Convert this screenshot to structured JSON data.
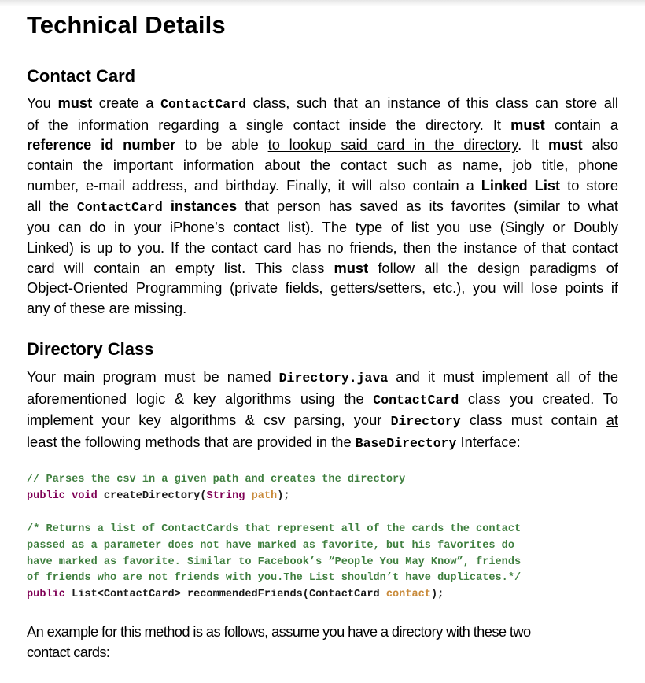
{
  "document": {
    "title": "Technical Details",
    "sections": [
      {
        "heading": "Contact Card",
        "paragraph_lines": [
          [
            "You ",
            {
              "b": "must"
            },
            " create a ",
            {
              "code": "ContactCard"
            },
            " class, such that an instance of this class can store all"
          ],
          [
            "of the information regarding a single contact inside the directory. It ",
            {
              "b": "must"
            },
            " contain a"
          ],
          [
            {
              "b": "reference id number"
            },
            " to be able ",
            {
              "u": "to lookup said card in the directory"
            },
            ". It ",
            {
              "b": "must"
            },
            " also"
          ],
          [
            "contain the important information about the contact such as name, job title, phone"
          ],
          [
            "number, e-mail address, and birthday. Finally, it will also contain a ",
            {
              "b": "Linked List"
            },
            " to store"
          ],
          [
            "all the ",
            {
              "code": "ContactCard"
            },
            " ",
            {
              "b": "instances"
            },
            " that person has saved as its favorites (similar to what"
          ],
          [
            "you can do in your iPhone’s contact list). The type of list you use (Singly or Doubly"
          ],
          [
            "Linked) is up to you. If the contact card has no friends, then the instance of that contact"
          ],
          [
            "card will contain an empty list. This class ",
            {
              "b": "must"
            },
            " follow ",
            {
              "u": "all the design paradigms"
            },
            " of"
          ],
          [
            "Object-Oriented Programming (private fields, getters/setters, etc.), you will lose points if"
          ],
          [
            "any of these are missing."
          ]
        ]
      },
      {
        "heading": "Directory Class",
        "paragraph_lines": [
          [
            "Your main program must be named ",
            {
              "code": "Directory.java"
            },
            " and it must implement all of the"
          ],
          [
            "aforementioned logic & key algorithms using the ",
            {
              "code": "ContactCard"
            },
            " class you created. To"
          ],
          [
            "implement your key algorithms & csv parsing, your ",
            {
              "code": "Directory"
            },
            " class must contain ",
            {
              "u": "at"
            }
          ],
          [
            {
              "u": "least"
            },
            " the following methods that are provided in the ",
            {
              "code": "BaseDirectory"
            },
            " Interface:"
          ]
        ]
      }
    ],
    "code_blocks": [
      {
        "lines": [
          [
            {
              "cmt": "// Parses the csv in a given path and creates the directory"
            }
          ],
          [
            {
              "kw": "public"
            },
            " ",
            {
              "kw": "void"
            },
            " createDirectory(",
            {
              "kw": "String"
            },
            " ",
            {
              "prm": "path"
            },
            ");"
          ]
        ]
      },
      {
        "lines": [
          [
            {
              "cmt": "/* Returns a list of ContactCards that represent all of the cards the contact"
            }
          ],
          [
            {
              "cmt": "passed as a parameter does not have marked as favorite, but his favorites do"
            }
          ],
          [
            {
              "cmt": "have marked as favorite. Similar to Facebook’s “People You May Know”, friends"
            }
          ],
          [
            {
              "cmt": "of friends who are not friends with you.The List shouldn’t have duplicates.*/"
            }
          ],
          [
            {
              "kw": "public"
            },
            " List<ContactCard> recommendedFriends(ContactCard ",
            {
              "prm": "contact"
            },
            ");"
          ]
        ]
      }
    ],
    "closing_paragraph_lines": [
      "An example for this method is as follows, assume you have a directory with these two",
      "contact cards:"
    ]
  },
  "colors": {
    "comment": "#3f7f3f",
    "keyword": "#7f0055",
    "parameter": "#c88a3a",
    "text": "#000000"
  }
}
